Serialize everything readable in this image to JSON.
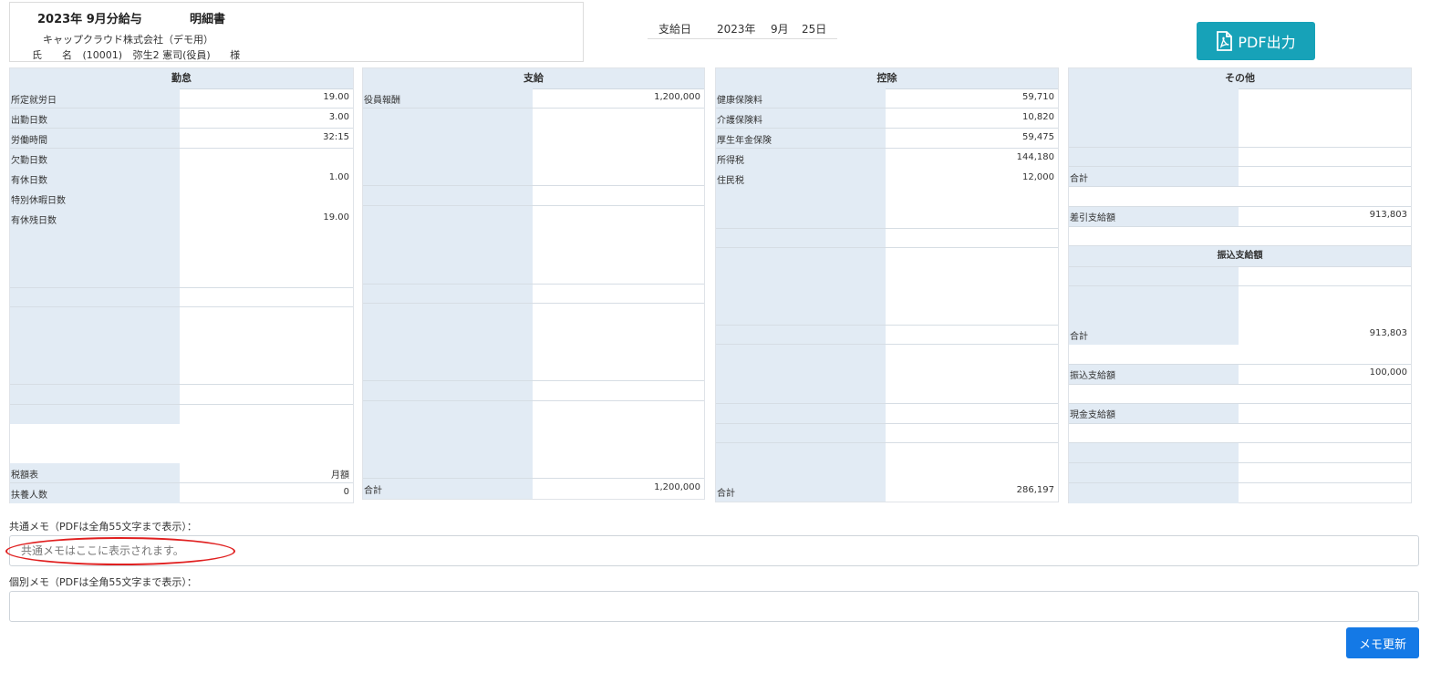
{
  "header": {
    "title": "2023年 9月分給与",
    "doc_type": "明細書",
    "company": "キャップクラウド株式会社（デモ用）",
    "name_label": "氏　　名",
    "employee_id": "(10001)",
    "employee_name": "弥生2 憲司(役員)",
    "honorific": "様"
  },
  "payday": {
    "label": "支給日",
    "year": "2023年",
    "month": "9月",
    "day": "25日"
  },
  "pdf_button": {
    "label": "PDF出力"
  },
  "attendance": {
    "title": "勤怠",
    "rows": [
      {
        "label": "所定就労日",
        "value": "19.00"
      },
      {
        "label": "出勤日数",
        "value": "3.00"
      },
      {
        "label": "労働時間",
        "value": "32:15"
      },
      {
        "label": "欠勤日数",
        "value": ""
      },
      {
        "label": "有休日数",
        "value": "1.00"
      },
      {
        "label": "特別休暇日数",
        "value": ""
      },
      {
        "label": "有休残日数",
        "value": "19.00"
      }
    ],
    "footer_rows": [
      {
        "label": "税額表",
        "value": "月額"
      },
      {
        "label": "扶養人数",
        "value": "0"
      }
    ]
  },
  "payment": {
    "title": "支給",
    "rows": [
      {
        "label": "役員報酬",
        "value": "1,200,000"
      }
    ],
    "total": {
      "label": "合計",
      "value": "1,200,000"
    }
  },
  "deduction": {
    "title": "控除",
    "rows": [
      {
        "label": "健康保険料",
        "value": "59,710"
      },
      {
        "label": "介護保険料",
        "value": "10,820"
      },
      {
        "label": "厚生年金保険",
        "value": "59,475"
      },
      {
        "label": "所得税",
        "value": "144,180"
      },
      {
        "label": "住民税",
        "value": "12,000"
      }
    ],
    "total": {
      "label": "合計",
      "value": "286,197"
    }
  },
  "other": {
    "title": "その他",
    "subtotal_label": "合計",
    "net_label": "差引支給額",
    "net_value": "913,803",
    "transfer_title": "振込支給額",
    "total_label": "合計",
    "total_value": "913,803",
    "bank_label": "振込支給額",
    "bank_value": "100,000",
    "cash_label": "現金支給額"
  },
  "common_memo": {
    "label": "共通メモ（PDFは全角55文字まで表示）：",
    "placeholder": "共通メモはここに表示されます。"
  },
  "individual_memo": {
    "label": "個別メモ（PDFは全角55文字まで表示）：",
    "placeholder": ""
  },
  "update_button": {
    "label": "メモ更新"
  }
}
